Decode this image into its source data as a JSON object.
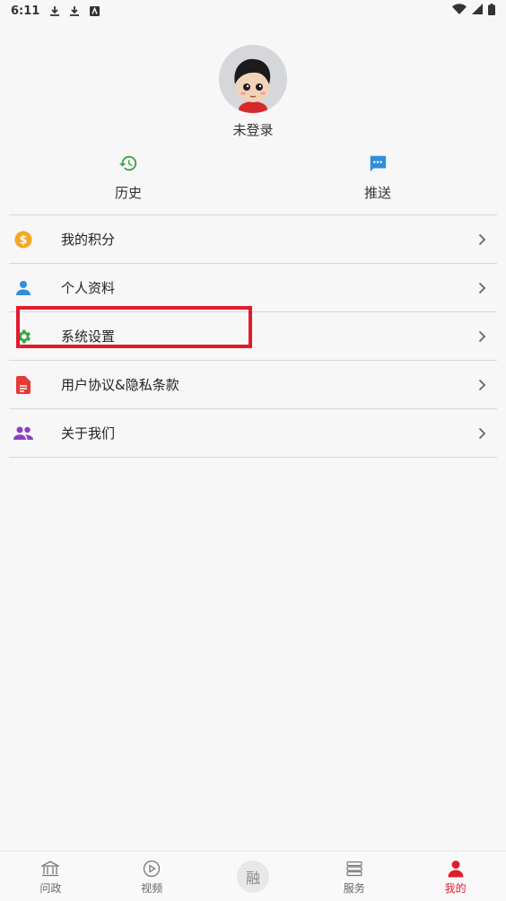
{
  "status_bar": {
    "time": "6:11"
  },
  "profile": {
    "username": "未登录"
  },
  "quick_actions": [
    {
      "label": "历史",
      "icon": "history-icon",
      "color": "#3aa345"
    },
    {
      "label": "推送",
      "icon": "message-icon",
      "color": "#2f8fde"
    }
  ],
  "menu": [
    {
      "label": "我的积分",
      "icon": "coin-icon",
      "color": "#f5a623"
    },
    {
      "label": "个人资料",
      "icon": "person-icon",
      "color": "#2f8fde"
    },
    {
      "label": "系统设置",
      "icon": "settings-icon",
      "color": "#3aa345"
    },
    {
      "label": "用户协议&隐私条款",
      "icon": "document-icon",
      "color": "#e53935"
    },
    {
      "label": "关于我们",
      "icon": "group-icon",
      "color": "#8e3cc7"
    }
  ],
  "tabbar": [
    {
      "label": "问政",
      "icon": "government-icon",
      "active": false
    },
    {
      "label": "视频",
      "icon": "play-icon",
      "active": false
    },
    {
      "label": "融",
      "icon": "center-icon",
      "active": false
    },
    {
      "label": "服务",
      "icon": "list-icon",
      "active": false
    },
    {
      "label": "我的",
      "icon": "profile-icon",
      "active": true
    }
  ],
  "colors": {
    "accent": "#e21b2b",
    "background": "#f7f7f7"
  }
}
